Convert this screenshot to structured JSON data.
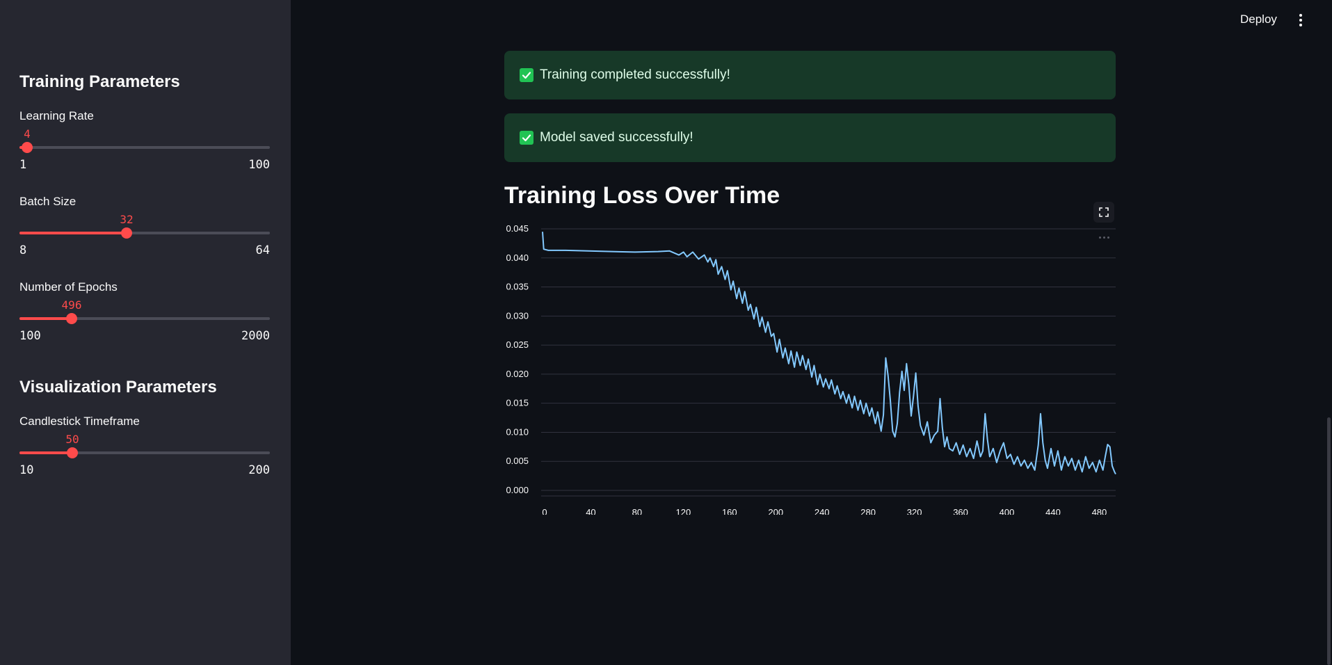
{
  "header": {
    "deploy_label": "Deploy"
  },
  "sidebar": {
    "training_heading": "Training Parameters",
    "visualization_heading": "Visualization Parameters",
    "sliders": [
      {
        "label": "Learning Rate",
        "value": "4",
        "min": "1",
        "max": "100",
        "fraction": 0.0303
      },
      {
        "label": "Batch Size",
        "value": "32",
        "min": "8",
        "max": "64",
        "fraction": 0.4286
      },
      {
        "label": "Number of Epochs",
        "value": "496",
        "min": "100",
        "max": "2000",
        "fraction": 0.2084
      },
      {
        "label": "Candlestick Timeframe",
        "value": "50",
        "min": "10",
        "max": "200",
        "fraction": 0.2105
      }
    ]
  },
  "alerts": [
    {
      "text": "Training completed successfully!",
      "icon": "check-icon"
    },
    {
      "text": "Model saved successfully!",
      "icon": "check-icon"
    }
  ],
  "chart": {
    "heading": "Training Loss Over Time"
  },
  "colors": {
    "accent": "#ff4b4b",
    "line": "#83c9ff",
    "success_bg": "#173928",
    "success_icon": "#21c354"
  },
  "chart_data": {
    "type": "line",
    "xlim": [
      0,
      496
    ],
    "ylim": [
      0,
      0.045
    ],
    "xticks": [
      0,
      40,
      80,
      120,
      160,
      200,
      240,
      280,
      320,
      360,
      400,
      440,
      480
    ],
    "yticks": [
      "0.000",
      "0.005",
      "0.010",
      "0.015",
      "0.020",
      "0.025",
      "0.030",
      "0.035",
      "0.040",
      "0.045"
    ],
    "grid": true,
    "x": [
      0,
      1,
      5,
      20,
      40,
      60,
      80,
      100,
      110,
      118,
      122,
      125,
      130,
      135,
      140,
      143,
      145,
      148,
      150,
      152,
      155,
      158,
      160,
      163,
      165,
      168,
      170,
      173,
      175,
      178,
      180,
      183,
      185,
      188,
      190,
      193,
      195,
      198,
      200,
      203,
      205,
      208,
      210,
      213,
      215,
      218,
      220,
      223,
      225,
      228,
      230,
      233,
      235,
      238,
      240,
      243,
      245,
      248,
      250,
      253,
      255,
      258,
      260,
      263,
      265,
      268,
      270,
      273,
      275,
      278,
      280,
      283,
      285,
      288,
      290,
      293,
      295,
      297,
      299,
      301,
      303,
      305,
      307,
      309,
      311,
      313,
      315,
      317,
      319,
      321,
      323,
      325,
      327,
      330,
      333,
      336,
      339,
      342,
      344,
      346,
      348,
      350,
      352,
      355,
      358,
      361,
      364,
      367,
      370,
      373,
      376,
      379,
      381,
      383,
      385,
      387,
      390,
      393,
      396,
      399,
      402,
      405,
      408,
      411,
      414,
      417,
      420,
      423,
      426,
      429,
      431,
      433,
      435,
      437,
      440,
      443,
      446,
      449,
      452,
      455,
      458,
      461,
      464,
      467,
      470,
      473,
      476,
      479,
      482,
      485,
      487,
      489,
      491,
      493,
      495,
      496
    ],
    "y": [
      0.0445,
      0.0415,
      0.0413,
      0.0413,
      0.0412,
      0.0411,
      0.041,
      0.0411,
      0.0412,
      0.0405,
      0.041,
      0.0402,
      0.041,
      0.0398,
      0.0405,
      0.0393,
      0.04,
      0.0385,
      0.0397,
      0.0372,
      0.0385,
      0.0363,
      0.0378,
      0.0345,
      0.036,
      0.033,
      0.0348,
      0.0322,
      0.0342,
      0.031,
      0.032,
      0.0295,
      0.0315,
      0.0282,
      0.0298,
      0.0272,
      0.029,
      0.0265,
      0.027,
      0.0238,
      0.026,
      0.0228,
      0.0245,
      0.0218,
      0.024,
      0.0212,
      0.0238,
      0.0215,
      0.0232,
      0.0208,
      0.0226,
      0.0195,
      0.0215,
      0.0182,
      0.02,
      0.0178,
      0.0192,
      0.0175,
      0.019,
      0.0166,
      0.018,
      0.0158,
      0.017,
      0.015,
      0.0165,
      0.0142,
      0.0162,
      0.0138,
      0.0155,
      0.0132,
      0.015,
      0.0128,
      0.0142,
      0.0115,
      0.0135,
      0.0102,
      0.013,
      0.0228,
      0.0198,
      0.0155,
      0.0102,
      0.0092,
      0.0115,
      0.0168,
      0.0205,
      0.0172,
      0.0218,
      0.0182,
      0.0128,
      0.0162,
      0.0202,
      0.0145,
      0.0112,
      0.0095,
      0.0118,
      0.0082,
      0.0095,
      0.0102,
      0.0158,
      0.0108,
      0.0075,
      0.0092,
      0.0072,
      0.0068,
      0.0082,
      0.0062,
      0.0078,
      0.0058,
      0.0072,
      0.0055,
      0.0085,
      0.0058,
      0.0068,
      0.0132,
      0.0088,
      0.0058,
      0.0072,
      0.0048,
      0.0068,
      0.0082,
      0.0055,
      0.0062,
      0.0045,
      0.0058,
      0.0042,
      0.0052,
      0.0038,
      0.0048,
      0.0035,
      0.0078,
      0.0132,
      0.0082,
      0.0052,
      0.0038,
      0.0072,
      0.0042,
      0.0068,
      0.0035,
      0.0058,
      0.0042,
      0.0055,
      0.0035,
      0.0052,
      0.0032,
      0.0058,
      0.0038,
      0.0048,
      0.0032,
      0.0052,
      0.0035,
      0.0058,
      0.0079,
      0.0075,
      0.0042,
      0.0032,
      0.0028,
      0.0025
    ]
  }
}
